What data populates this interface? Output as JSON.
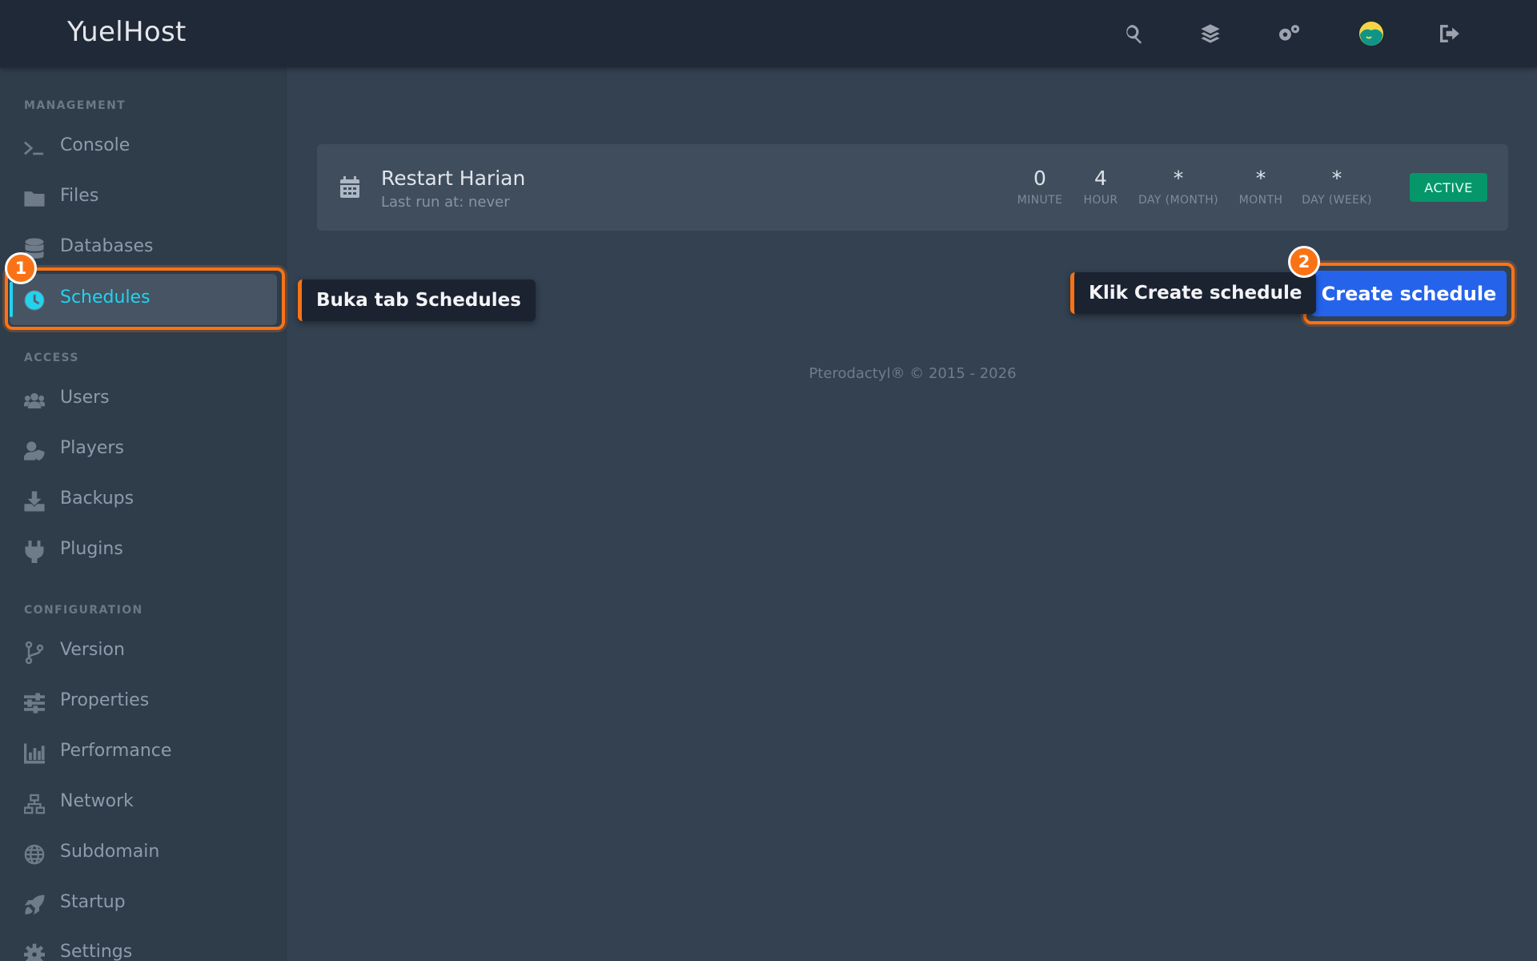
{
  "app": {
    "brand": "YuelHost"
  },
  "topbar": {
    "icons": [
      "search-icon",
      "layers-icon",
      "settings-icon",
      "avatar",
      "logout-icon"
    ]
  },
  "sidebar": {
    "sections": [
      {
        "label": "MANAGEMENT"
      },
      {
        "label": "ACCESS"
      },
      {
        "label": "CONFIGURATION"
      }
    ],
    "items": [
      {
        "label": "Console",
        "icon": "terminal-icon"
      },
      {
        "label": "Files",
        "icon": "folder-icon"
      },
      {
        "label": "Databases",
        "icon": "database-icon"
      },
      {
        "label": "Schedules",
        "icon": "clock-icon",
        "active": true
      },
      {
        "label": "Users",
        "icon": "users-icon"
      },
      {
        "label": "Players",
        "icon": "player-shield-icon"
      },
      {
        "label": "Backups",
        "icon": "download-icon"
      },
      {
        "label": "Plugins",
        "icon": "plug-icon"
      },
      {
        "label": "Version",
        "icon": "branch-icon"
      },
      {
        "label": "Properties",
        "icon": "sliders-icon"
      },
      {
        "label": "Performance",
        "icon": "chart-icon"
      },
      {
        "label": "Network",
        "icon": "network-icon"
      },
      {
        "label": "Subdomain",
        "icon": "globe-icon"
      },
      {
        "label": "Startup",
        "icon": "rocket-icon"
      },
      {
        "label": "Settings",
        "icon": "gear-icon"
      }
    ]
  },
  "schedule": {
    "name": "Restart Harian",
    "last_run": "Last run at: never",
    "cron": [
      {
        "value": "0",
        "label": "MINUTE"
      },
      {
        "value": "4",
        "label": "HOUR"
      },
      {
        "value": "*",
        "label": "DAY (MONTH)"
      },
      {
        "value": "*",
        "label": "MONTH"
      },
      {
        "value": "*",
        "label": "DAY (WEEK)"
      }
    ],
    "status": "ACTIVE"
  },
  "actions": {
    "create_label": "Create schedule"
  },
  "annotations": {
    "step1": {
      "number": "1",
      "text": "Buka tab Schedules"
    },
    "step2": {
      "number": "2",
      "text": "Klik Create schedule"
    }
  },
  "colors": {
    "accent": "#22d3ee",
    "highlight": "#f97316",
    "primary_button": "#2563eb",
    "status_active": "#059669"
  },
  "footer": {
    "text": "Pterodactyl® © 2015 - 2026"
  }
}
